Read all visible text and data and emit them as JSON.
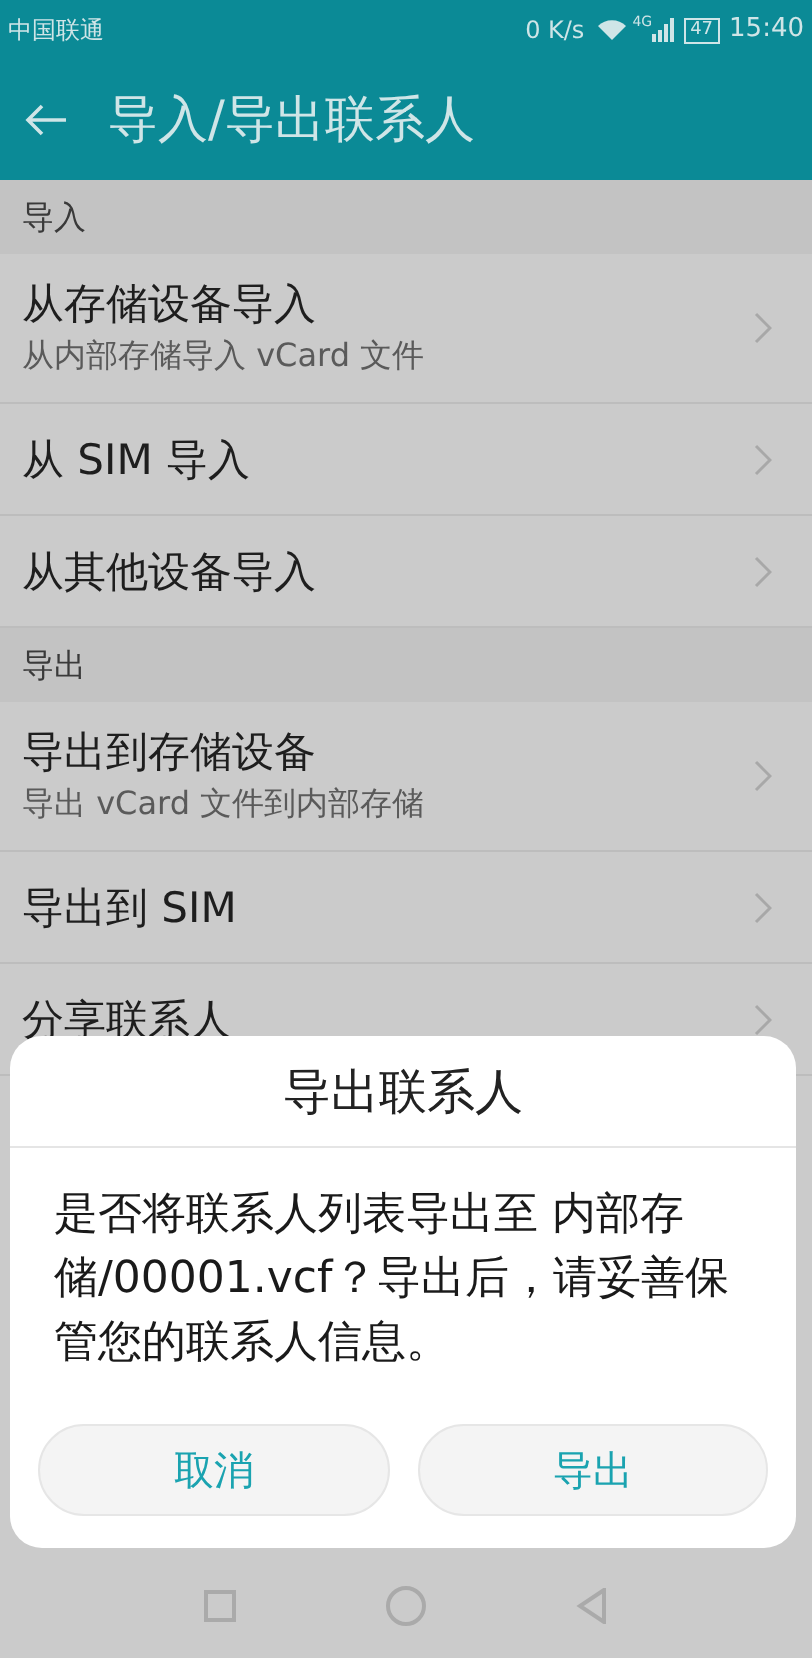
{
  "status_bar": {
    "carrier": "中国联通",
    "speed": "0 K/s",
    "network": "4G",
    "battery": "47",
    "time": "15:40"
  },
  "app_bar": {
    "title": "导入/导出联系人"
  },
  "sections": [
    {
      "header": "导入",
      "items": [
        {
          "title": "从存储设备导入",
          "subtitle": "从内部存储导入 vCard 文件"
        },
        {
          "title": "从 SIM 导入"
        },
        {
          "title": "从其他设备导入"
        }
      ]
    },
    {
      "header": "导出",
      "items": [
        {
          "title": "导出到存储设备",
          "subtitle": "导出 vCard 文件到内部存储"
        },
        {
          "title": "导出到 SIM"
        },
        {
          "title": "分享联系人"
        }
      ]
    }
  ],
  "dialog": {
    "title": "导出联系人",
    "message": "是否将联系人列表导出至 内部存储/00001.vcf？导出后，请妥善保管您的联系人信息。",
    "buttons": [
      "取消",
      "导出"
    ]
  }
}
